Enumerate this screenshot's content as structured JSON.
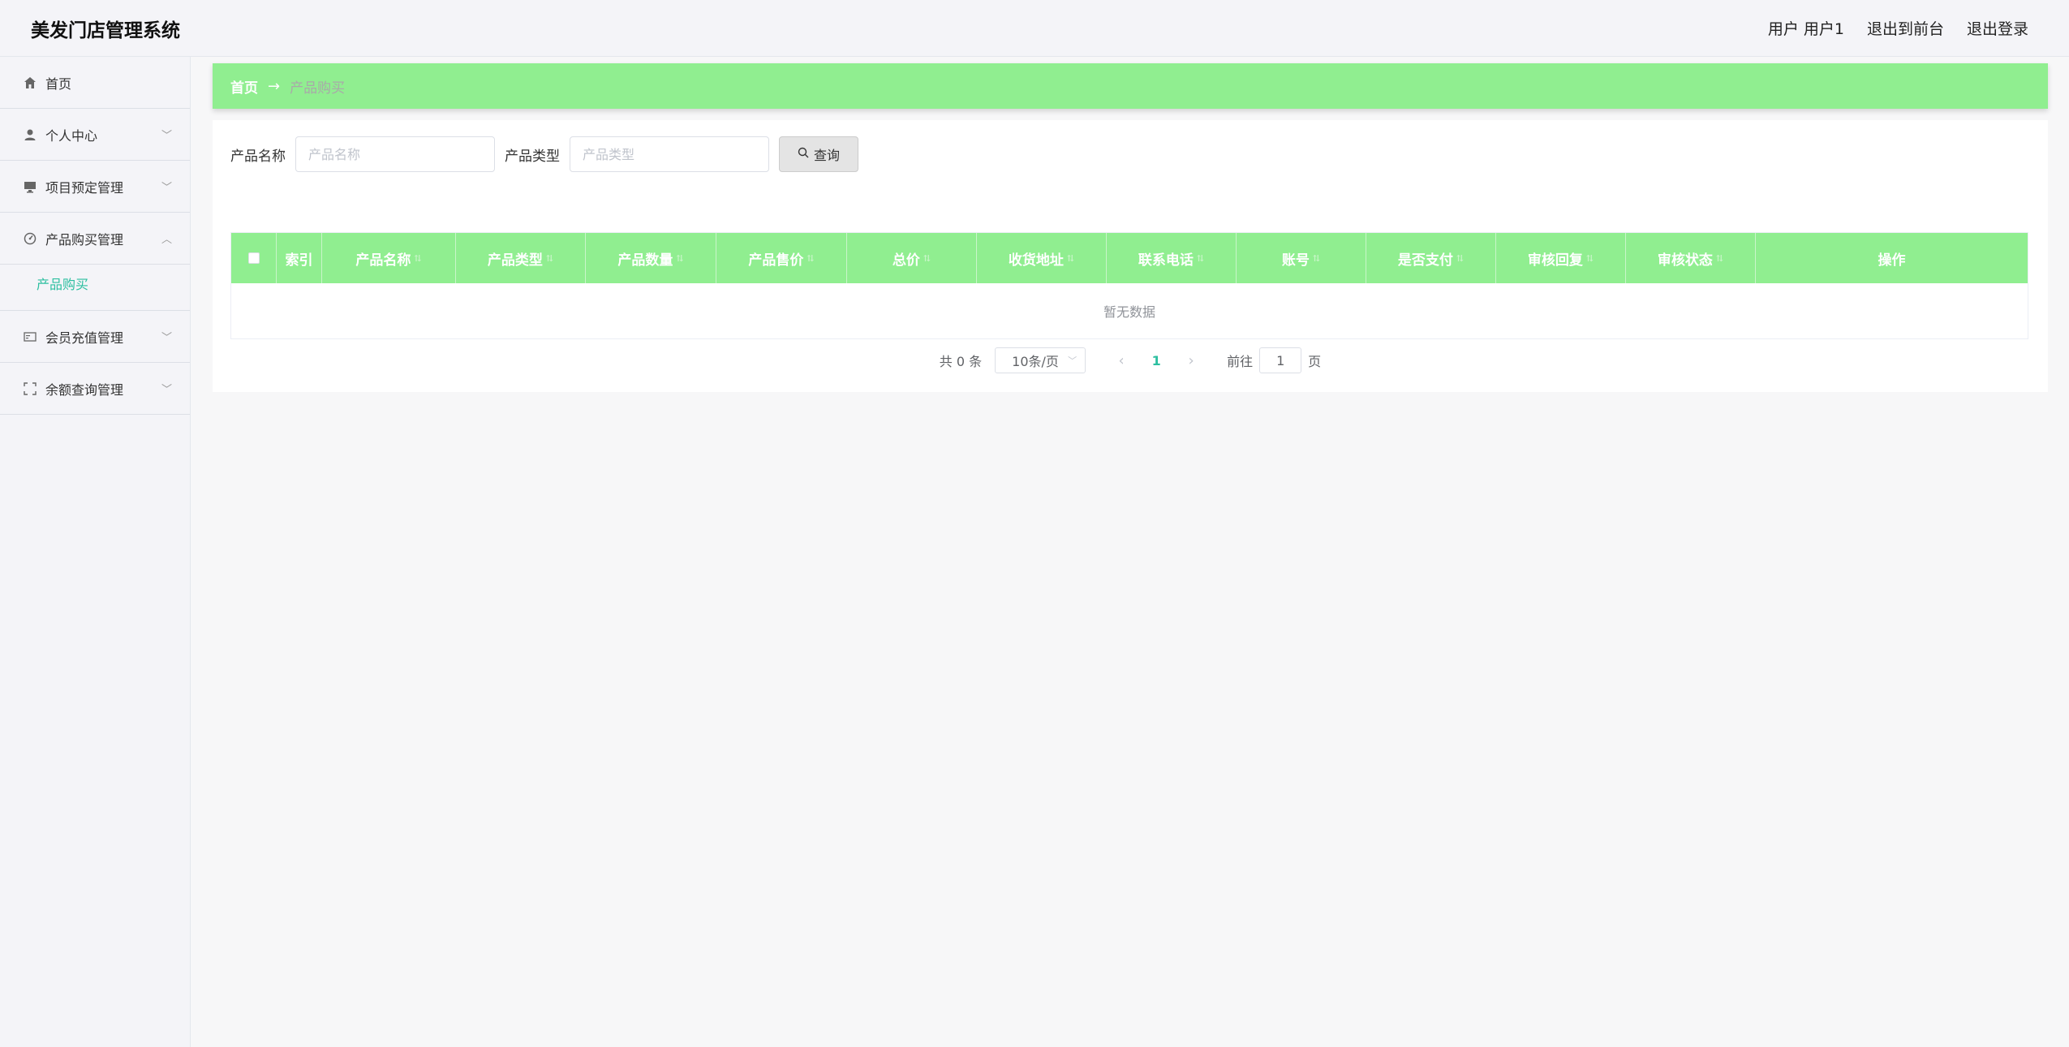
{
  "header": {
    "title": "美发门店管理系统",
    "user_label": "用户 用户1",
    "back_to_front": "退出到前台",
    "logout": "退出登录"
  },
  "sidebar": {
    "items": [
      {
        "label": "首页",
        "icon": "home-icon"
      },
      {
        "label": "个人中心",
        "icon": "user-icon"
      },
      {
        "label": "项目预定管理",
        "icon": "monitor-icon"
      },
      {
        "label": "产品购买管理",
        "icon": "dashboard-icon"
      },
      {
        "label": "会员充值管理",
        "icon": "card-icon"
      },
      {
        "label": "余额查询管理",
        "icon": "fullscreen-icon"
      }
    ],
    "submenu": {
      "label": "产品购买"
    }
  },
  "breadcrumb": {
    "home": "首页",
    "arrow": "→",
    "current": "产品购买"
  },
  "search": {
    "name_label": "产品名称",
    "name_placeholder": "产品名称",
    "type_label": "产品类型",
    "type_placeholder": "产品类型",
    "button_label": "查询"
  },
  "table": {
    "columns": [
      "索引",
      "产品名称",
      "产品类型",
      "产品数量",
      "产品售价",
      "总价",
      "收货地址",
      "联系电话",
      "账号",
      "是否支付",
      "审核回复",
      "审核状态",
      "操作"
    ],
    "empty_text": "暂无数据"
  },
  "pagination": {
    "total": "共 0 条",
    "page_size": "10条/页",
    "current_page": "1",
    "goto_label": "前往",
    "goto_value": "1",
    "page_suffix": "页"
  },
  "colors": {
    "accent": "#90ee90",
    "active_text": "#2dbfa0"
  }
}
